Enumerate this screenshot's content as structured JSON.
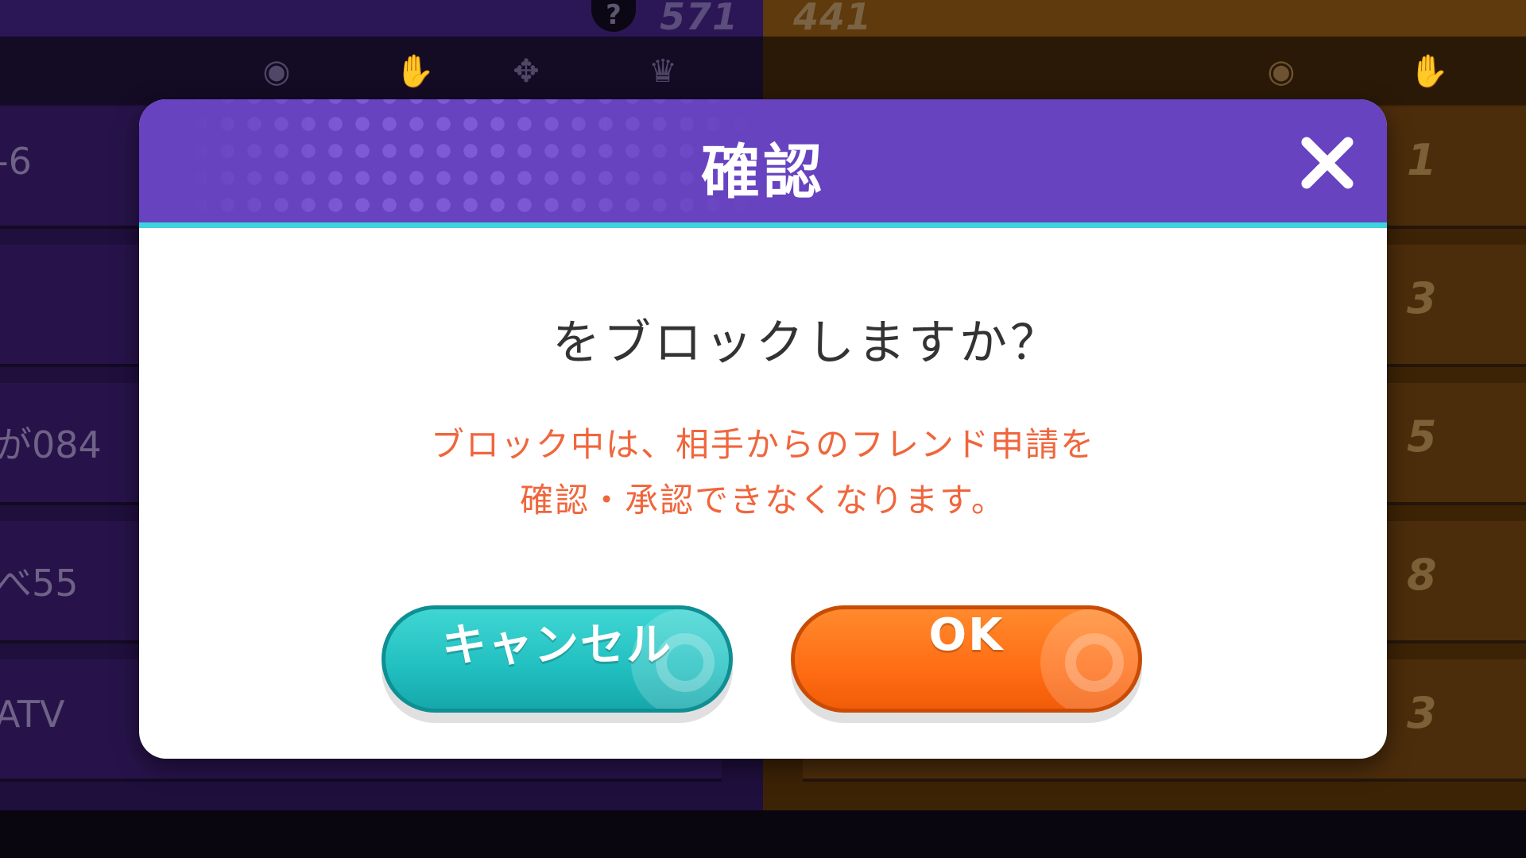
{
  "background": {
    "left_score": "571",
    "right_score": "441",
    "help_icon": "?",
    "left_rows": [
      "-6",
      "",
      "が084",
      "べ55",
      "ATV"
    ],
    "right_ranks": [
      "1",
      "3",
      "5",
      "8",
      "3"
    ]
  },
  "dialog": {
    "title": "確認",
    "close_icon": "close-icon",
    "question": "をブロックしますか？",
    "warning_line1": "ブロック中は、相手からのフレンド申請を",
    "warning_line2": "確認・承認できなくなります。",
    "cancel_label": "キャンセル",
    "ok_label": "OK"
  },
  "colors": {
    "header": "#6743c0",
    "header_border": "#3fd3dc",
    "warning_text": "#f0663c",
    "cancel_button": "#21bfc0",
    "ok_button": "#ff6d14"
  }
}
